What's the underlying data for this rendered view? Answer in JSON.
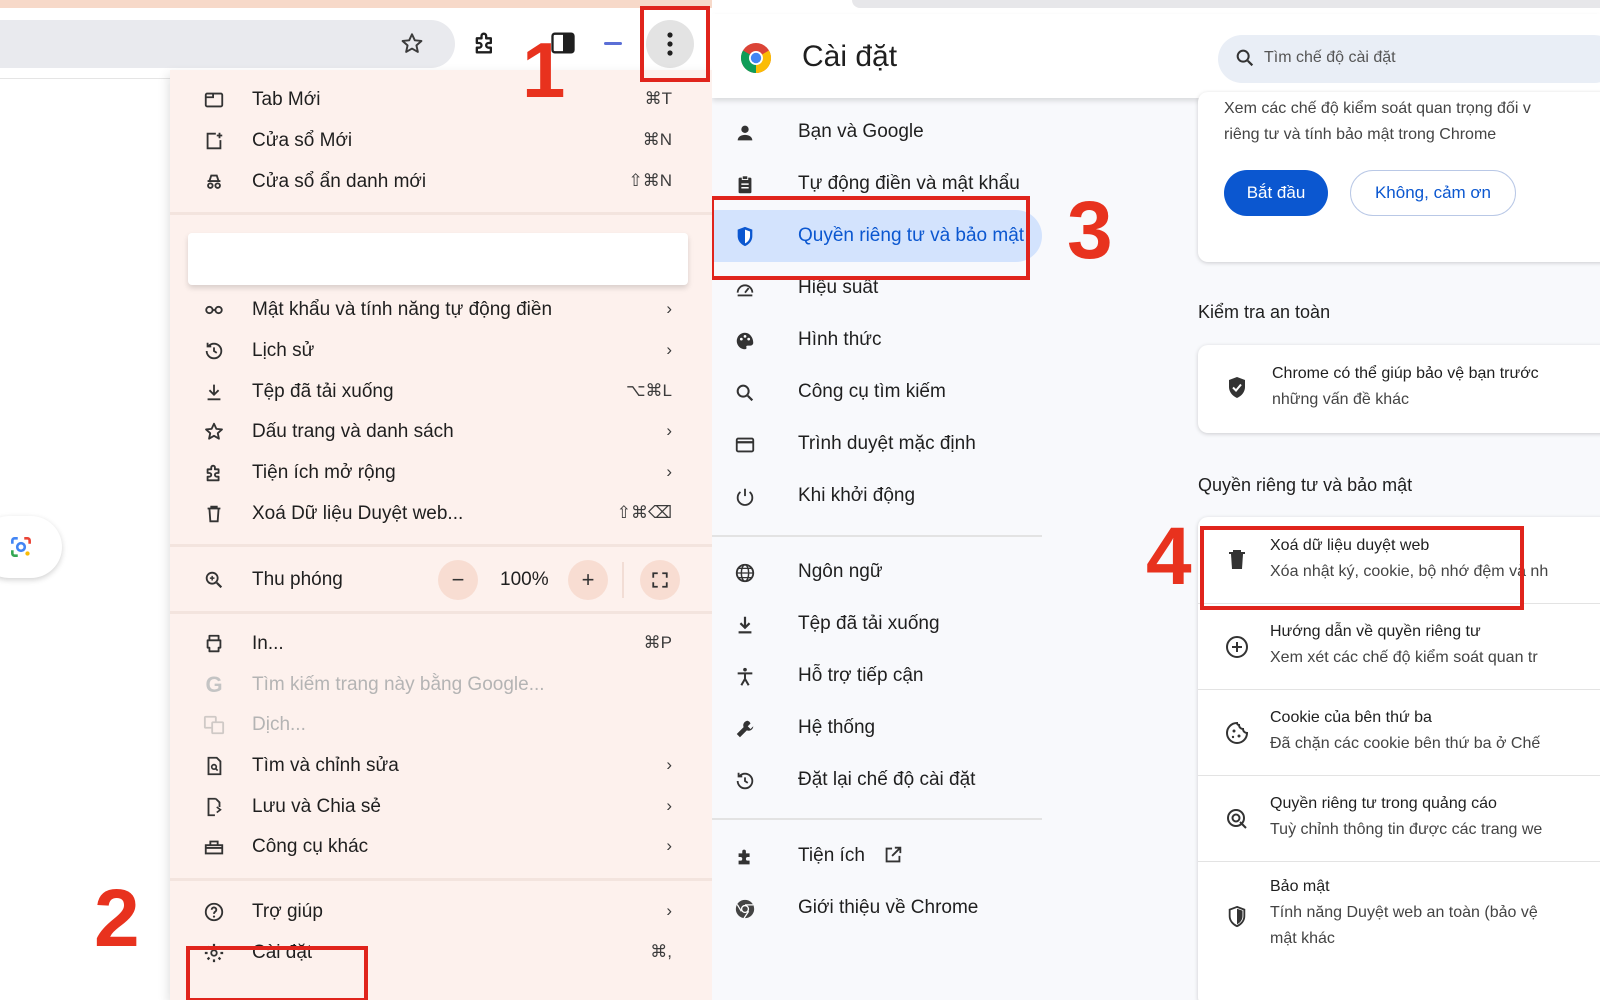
{
  "annotations": {
    "step1": "1",
    "step2": "2",
    "step3": "3",
    "step4": "4"
  },
  "chrome_menu": {
    "items_top": [
      {
        "label": "Tab Mới",
        "shortcut": "⌘T",
        "icon": "new-tab-icon"
      },
      {
        "label": "Cửa sổ Mới",
        "shortcut": "⌘N",
        "icon": "new-window-icon"
      },
      {
        "label": "Cửa sổ ẩn danh mới",
        "shortcut": "⇧⌘N",
        "icon": "incognito-icon"
      }
    ],
    "items_mid": [
      {
        "label": "Mật khẩu và tính năng tự động điền",
        "right": "›",
        "icon": "key-icon"
      },
      {
        "label": "Lịch sử",
        "right": "›",
        "icon": "history-icon"
      },
      {
        "label": "Tệp đã tải xuống",
        "right": "⌥⌘L",
        "icon": "download-icon"
      },
      {
        "label": "Dấu trang và danh sách",
        "right": "›",
        "icon": "star-icon"
      },
      {
        "label": "Tiện ích mở rộng",
        "right": "›",
        "icon": "puzzle-icon"
      },
      {
        "label": "Xoá Dữ liệu Duyệt web...",
        "right": "⇧⌘⌫",
        "icon": "trash-icon"
      }
    ],
    "zoom": {
      "label": "Thu phóng",
      "value": "100%",
      "minus": "−",
      "plus": "+"
    },
    "items_tools": [
      {
        "label": "In...",
        "right": "⌘P",
        "icon": "print-icon",
        "disabled": false
      },
      {
        "label": "Tìm kiếm trang này bằng Google...",
        "right": "",
        "icon": "google-g-icon",
        "disabled": true
      },
      {
        "label": "Dịch...",
        "right": "",
        "icon": "translate-icon",
        "disabled": true
      },
      {
        "label": "Tìm và chỉnh sửa",
        "right": "›",
        "icon": "find-edit-icon",
        "disabled": false
      },
      {
        "label": "Lưu và Chia sẻ",
        "right": "›",
        "icon": "save-share-icon",
        "disabled": false
      },
      {
        "label": "Công cụ khác",
        "right": "›",
        "icon": "toolbox-icon",
        "disabled": false
      }
    ],
    "items_bottom": [
      {
        "label": "Trợ giúp",
        "right": "›",
        "icon": "help-icon"
      },
      {
        "label": "Cài đặt",
        "right": "⌘,",
        "icon": "gear-icon"
      }
    ]
  },
  "settings": {
    "title": "Cài đặt",
    "search_placeholder": "Tìm chế độ cài đặt",
    "nav_group1": [
      {
        "label": "Bạn và Google",
        "icon": "person-icon",
        "active": false
      },
      {
        "label": "Tự động điền và mật khẩu",
        "icon": "clipboard-icon",
        "active": false
      },
      {
        "label": "Quyền riêng tư và bảo mật",
        "icon": "shield-icon",
        "active": true
      },
      {
        "label": "Hiệu suất",
        "icon": "speedometer-icon",
        "active": false
      },
      {
        "label": "Hình thức",
        "icon": "palette-icon",
        "active": false
      },
      {
        "label": "Công cụ tìm kiếm",
        "icon": "search-icon",
        "active": false
      },
      {
        "label": "Trình duyệt mặc định",
        "icon": "browser-window-icon",
        "active": false
      },
      {
        "label": "Khi khởi động",
        "icon": "power-icon",
        "active": false
      }
    ],
    "nav_group2": [
      {
        "label": "Ngôn ngữ",
        "icon": "globe-icon"
      },
      {
        "label": "Tệp đã tải xuống",
        "icon": "download-icon"
      },
      {
        "label": "Hỗ trợ tiếp cận",
        "icon": "accessibility-icon"
      },
      {
        "label": "Hệ thống",
        "icon": "wrench-icon"
      },
      {
        "label": "Đặt lại chế độ cài đặt",
        "icon": "reset-icon"
      }
    ],
    "nav_group3": [
      {
        "label": "Tiện ích",
        "icon": "puzzle-icon",
        "extra_icon": "external-link-icon"
      },
      {
        "label": "Giới thiệu về Chrome",
        "icon": "chrome-icon"
      }
    ],
    "guide_card": {
      "line1": "Xem các chế độ kiểm soát quan trọng đối v",
      "line2": "riêng tư và tính bảo mật trong Chrome",
      "primary": "Bắt đầu",
      "secondary": "Không, cảm ơn"
    },
    "safety_check": {
      "title": "Kiểm tra an toàn",
      "line1": "Chrome có thể giúp bảo vệ bạn trước",
      "line2": "những vấn đề khác"
    },
    "privacy_section": {
      "title": "Quyền riêng tư và bảo mật",
      "rows": [
        {
          "title": "Xoá dữ liệu duyệt web",
          "sub": "Xóa nhật ký, cookie, bộ nhớ đệm và nh",
          "icon": "trash-icon"
        },
        {
          "title": "Hướng dẫn về quyền riêng tư",
          "sub": "Xem xét các chế độ kiểm soát quan tr",
          "icon": "compass-plus-icon"
        },
        {
          "title": "Cookie của bên thứ ba",
          "sub": "Đã chặn các cookie bên thứ ba ở Chế",
          "icon": "cookie-icon"
        },
        {
          "title": "Quyền riêng tư trong quảng cáo",
          "sub": "Tuỳ chỉnh thông tin được các trang we",
          "icon": "ad-privacy-icon"
        },
        {
          "title": "Bảo mật",
          "sub": "Tính năng Duyệt web an toàn (bảo vệ",
          "sub2": "mật khác",
          "icon": "shield-icon"
        }
      ]
    }
  }
}
